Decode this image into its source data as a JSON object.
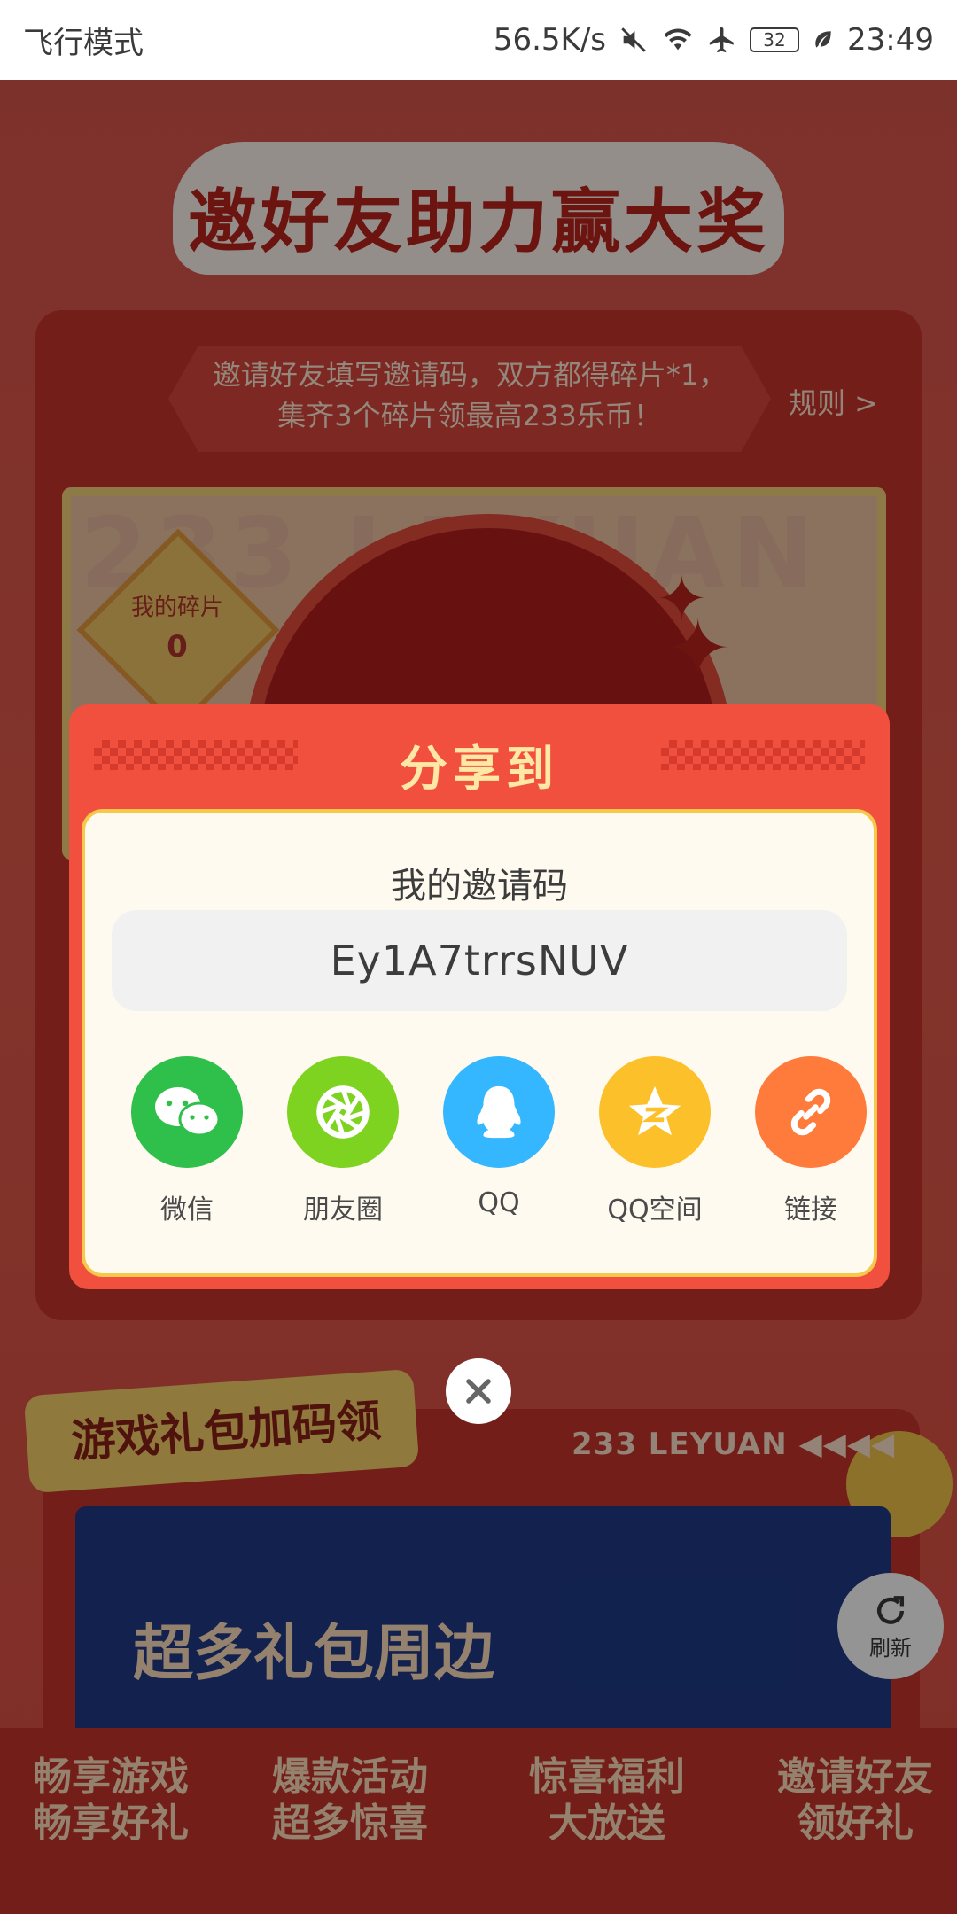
{
  "status_bar": {
    "mode": "飞行模式",
    "speed": "56.5K/s",
    "battery": "32",
    "time": "23:49",
    "icons": [
      "mute-icon",
      "wifi-icon",
      "airplane-icon",
      "battery-icon",
      "leaf-icon"
    ]
  },
  "page": {
    "title": "邀好友助力赢大奖",
    "intro": "邀请好友填写邀请码，双方都得碎片*1，集齐3个碎片领最高233乐币！",
    "rules": "规则 >",
    "watermark": "233 LEYUAN",
    "my_fragments_label": "我的碎片",
    "my_fragments_count": "0",
    "gift_section_title": "游戏礼包加码领",
    "brand_strip": "233 LEYUAN",
    "banner_text": "超多礼包周边",
    "refresh_label": "刷新",
    "footer": [
      {
        "line1": "畅享游戏",
        "line2": "畅享好礼"
      },
      {
        "line1": "爆款活动",
        "line2": "超多惊喜"
      },
      {
        "line1": "惊喜福利",
        "line2": "大放送"
      },
      {
        "line1": "邀请好友",
        "line2": "领好礼"
      }
    ]
  },
  "share_modal": {
    "title": "分享到",
    "code_label": "我的邀请码",
    "invite_code": "Ey1A7trrsNUV",
    "targets": [
      {
        "label": "微信",
        "color": "#2ec04a",
        "icon": "wechat-icon"
      },
      {
        "label": "朋友圈",
        "color": "#7ed321",
        "icon": "moments-icon"
      },
      {
        "label": "QQ",
        "color": "#35b7ff",
        "icon": "qq-icon"
      },
      {
        "label": "QQ空间",
        "color": "#fcc02a",
        "icon": "qzone-icon"
      },
      {
        "label": "链接",
        "color": "#ff7b3b",
        "icon": "link-icon"
      }
    ],
    "close_icon": "close-icon"
  }
}
